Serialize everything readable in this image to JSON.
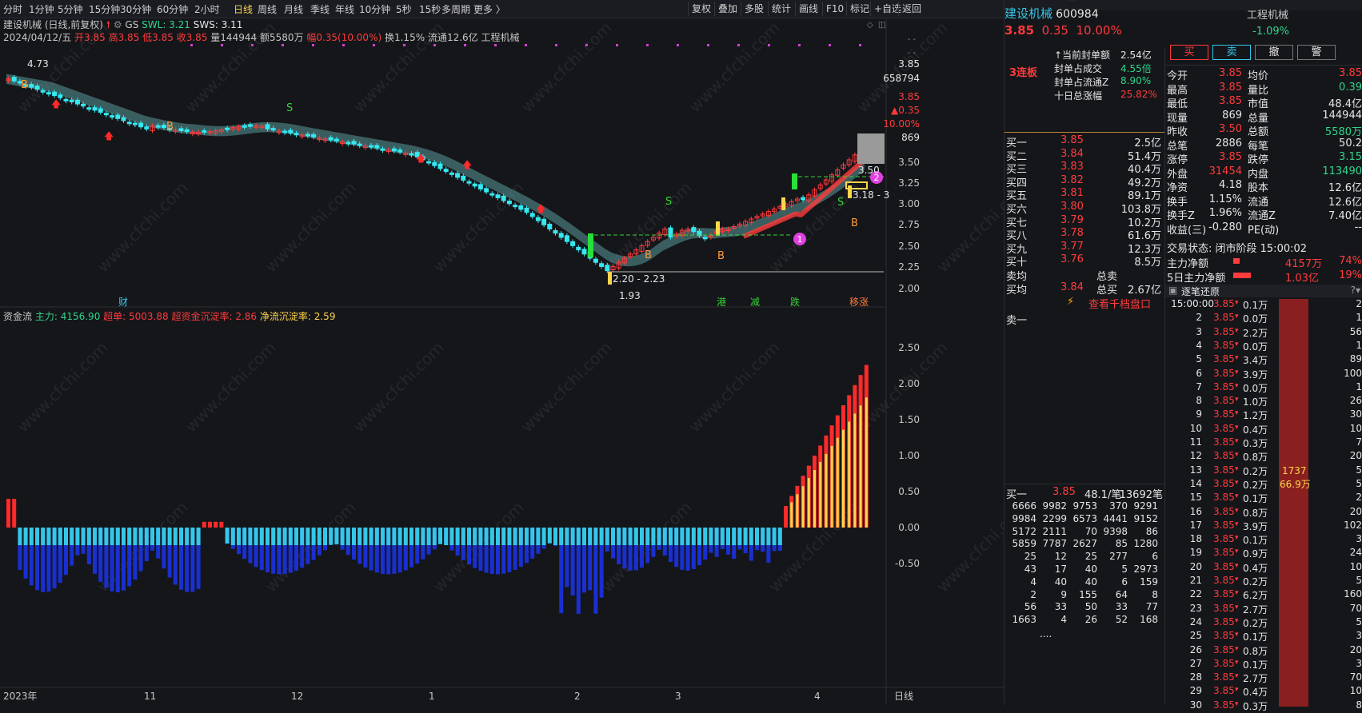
{
  "toolbar": {
    "periods": [
      "分时",
      "1分钟",
      "5分钟",
      "15分钟",
      "30分钟",
      "60分钟",
      "2小时",
      "日线",
      "周线",
      "月线",
      "季线",
      "年线",
      "10分钟",
      "5秒",
      "15秒",
      "多周期",
      "更多 〉"
    ],
    "active_period": "日线",
    "actions": [
      "复权",
      "叠加",
      "多股",
      "统计",
      "画线",
      "F10",
      "标记",
      "+自选",
      "返回"
    ]
  },
  "chart": {
    "title": "建设机械 (日线,前复权)",
    "indicator_gs": "GS",
    "swl": "SWL: 3.21",
    "sws": "SWS: 3.11",
    "ohlc_line": "2024/04/12/五",
    "open": "开3.85",
    "high": "高3.85",
    "low": "低3.85",
    "close": "收3.85",
    "volume": "量144944",
    "amount": "额5580万",
    "change": "幅0.35(10.00%)",
    "turnover": "换1.15%",
    "float": "流通12.6亿",
    "sector": "工程机械",
    "label_high": "4.73",
    "label_low": "1.93",
    "label_range1": "2.20 - 2.23",
    "label_range2": "3.18 - 3",
    "label_350": "3.50",
    "marker1": "1",
    "marker2": "2",
    "price_axis": [
      "3.50",
      "3.25",
      "3.00",
      "2.75",
      "2.50",
      "2.25",
      "2.00"
    ],
    "right_price": "3.85",
    "right_vol": "658794",
    "right_price_red": "3.85",
    "right_change": "▲0.35",
    "right_pct": "10.00%",
    "right_869": "869",
    "events": [
      "财",
      "港",
      "减",
      "跌",
      "移涨"
    ],
    "signals": [
      "B",
      "S"
    ]
  },
  "fund": {
    "title": "资金流",
    "main": "主力: 4156.90",
    "super": "超单: 5003.88",
    "super_rate": "超资金沉淀率: 2.86",
    "net_rate": "净流沉淀率: 2.59",
    "axis": [
      "2.50",
      "2.00",
      "1.50",
      "1.00",
      "0.50",
      "0.00",
      "-0.50"
    ]
  },
  "x_axis": [
    "2023年",
    "11",
    "12",
    "1",
    "2",
    "3",
    "4"
  ],
  "x_axis_right": "日线",
  "watermark": "www.cfchi.com",
  "quote": {
    "name": "建设机械",
    "code": "600984",
    "sector": "工程机械",
    "sector_pct": "-1.09%",
    "price": "3.85",
    "change": "0.35",
    "pct": "10.00%",
    "buttons": [
      "买",
      "卖",
      "撤",
      "警"
    ],
    "limit_tag": "3连板",
    "seal_amount_label": "↑当前封单额",
    "seal_amount": "2.54亿",
    "seal_deal_label": "封单占成交",
    "seal_deal": "4.55倍",
    "seal_float_label": "封单占流通Z",
    "seal_float": "8.90%",
    "ten_day_label": "十日总涨幅",
    "ten_day": "25.82%",
    "bids": [
      {
        "label": "买一",
        "price": "3.85",
        "vol": "2.5亿"
      },
      {
        "label": "买二",
        "price": "3.84",
        "vol": "51.4万"
      },
      {
        "label": "买三",
        "price": "3.83",
        "vol": "40.4万"
      },
      {
        "label": "买四",
        "price": "3.82",
        "vol": "49.2万"
      },
      {
        "label": "买五",
        "price": "3.81",
        "vol": "89.1万"
      },
      {
        "label": "买六",
        "price": "3.80",
        "vol": "103.8万"
      },
      {
        "label": "买七",
        "price": "3.79",
        "vol": "10.2万"
      },
      {
        "label": "买八",
        "price": "3.78",
        "vol": "61.6万"
      },
      {
        "label": "买九",
        "price": "3.77",
        "vol": "12.3万"
      },
      {
        "label": "买十",
        "price": "3.76",
        "vol": "8.5万"
      }
    ],
    "sell_avg_label": "卖均",
    "total_sell_label": "总卖",
    "buy_avg_label": "买均",
    "buy_avg": "3.84",
    "total_buy_label": "总买",
    "total_buy": "2.67亿",
    "view_levels": "查看千档盘口",
    "sell1_label": "卖一",
    "queue_head": {
      "label": "买一",
      "price": "3.85",
      "avg": "48.1/笔",
      "count": "13692笔"
    },
    "queue": [
      [
        "6666",
        "9982",
        "9753",
        "370",
        "9291"
      ],
      [
        "9984",
        "2299",
        "6573",
        "4441",
        "9152"
      ],
      [
        "5172",
        "2111",
        "70",
        "9398",
        "86"
      ],
      [
        "5859",
        "7787",
        "2627",
        "85",
        "1280"
      ],
      [
        "25",
        "12",
        "25",
        "277",
        "6"
      ],
      [
        "43",
        "17",
        "40",
        "5",
        "2973"
      ],
      [
        "4",
        "40",
        "40",
        "6",
        "159"
      ],
      [
        "2",
        "9",
        "155",
        "64",
        "8"
      ],
      [
        "56",
        "33",
        "50",
        "33",
        "77"
      ],
      [
        "1663",
        "4",
        "26",
        "52",
        "168"
      ]
    ],
    "queue_more": "....",
    "stats": [
      {
        "l1": "今开",
        "v1": "3.85",
        "l2": "均价",
        "v2": "3.85"
      },
      {
        "l1": "最高",
        "v1": "3.85",
        "l2": "量比",
        "v2": "0.39"
      },
      {
        "l1": "最低",
        "v1": "3.85",
        "l2": "市值",
        "v2": "48.4亿"
      },
      {
        "l1": "现量",
        "v1": "869",
        "l2": "总量",
        "v2": "144944"
      },
      {
        "l1": "昨收",
        "v1": "3.50",
        "l2": "总额",
        "v2": "5580万"
      },
      {
        "l1": "总笔",
        "v1": "2886",
        "l2": "每笔",
        "v2": "50.2"
      },
      {
        "l1": "涨停",
        "v1": "3.85",
        "l2": "跌停",
        "v2": "3.15"
      },
      {
        "l1": "外盘",
        "v1": "31454",
        "l2": "内盘",
        "v2": "113490"
      },
      {
        "l1": "净资",
        "v1": "4.18",
        "l2": "股本",
        "v2": "12.6亿"
      },
      {
        "l1": "换手",
        "v1": "1.15%",
        "l2": "流通",
        "v2": "12.6亿"
      },
      {
        "l1": "换手Z",
        "v1": "1.96%",
        "l2": "流通Z",
        "v2": "7.40亿"
      },
      {
        "l1": "收益(三)",
        "v1": "-0.280",
        "l2": "PE(动)",
        "v2": "--"
      }
    ],
    "trade_state": "交易状态: 闭市阶段 15:00:02",
    "main_net_label": "主力净额",
    "main_net": "4157万",
    "main_net_pct": "74%",
    "main_net5_label": "5日主力净额",
    "main_net5": "1.03亿",
    "main_net5_pct": "19%",
    "tick_title": "逐笔还原",
    "ticks": [
      {
        "t": "15:00:00",
        "p": "3.85",
        "v": "0.1万",
        "n": "2"
      },
      {
        "t": "2",
        "p": "3.85",
        "v": "0.0万",
        "n": "1"
      },
      {
        "t": "3",
        "p": "3.85",
        "v": "2.2万",
        "n": "56"
      },
      {
        "t": "4",
        "p": "3.85",
        "v": "0.0万",
        "n": "1"
      },
      {
        "t": "5",
        "p": "3.85",
        "v": "3.4万",
        "n": "89"
      },
      {
        "t": "6",
        "p": "3.85",
        "v": "3.9万",
        "n": "100"
      },
      {
        "t": "7",
        "p": "3.85",
        "v": "0.0万",
        "n": "1"
      },
      {
        "t": "8",
        "p": "3.85",
        "v": "1.0万",
        "n": "26"
      },
      {
        "t": "9",
        "p": "3.85",
        "v": "1.2万",
        "n": "30"
      },
      {
        "t": "10",
        "p": "3.85",
        "v": "0.4万",
        "n": "10"
      },
      {
        "t": "11",
        "p": "3.85",
        "v": "0.3万",
        "n": "7"
      },
      {
        "t": "12",
        "p": "3.85",
        "v": "0.8万",
        "n": "20"
      },
      {
        "t": "13",
        "p": "3.85",
        "v": "0.2万",
        "n": "5"
      },
      {
        "t": "14",
        "p": "3.85",
        "v": "0.2万",
        "n": "5"
      },
      {
        "t": "15",
        "p": "3.85",
        "v": "0.1万",
        "n": "2"
      },
      {
        "t": "16",
        "p": "3.85",
        "v": "0.8万",
        "n": "20"
      },
      {
        "t": "17",
        "p": "3.85",
        "v": "3.9万",
        "n": "102"
      },
      {
        "t": "18",
        "p": "3.85",
        "v": "0.1万",
        "n": "3"
      },
      {
        "t": "19",
        "p": "3.85",
        "v": "0.9万",
        "n": "24"
      },
      {
        "t": "20",
        "p": "3.85",
        "v": "0.4万",
        "n": "10"
      },
      {
        "t": "21",
        "p": "3.85",
        "v": "0.2万",
        "n": "5"
      },
      {
        "t": "22",
        "p": "3.85",
        "v": "6.2万",
        "n": "160"
      },
      {
        "t": "23",
        "p": "3.85",
        "v": "2.7万",
        "n": "70"
      },
      {
        "t": "24",
        "p": "3.85",
        "v": "0.2万",
        "n": "5"
      },
      {
        "t": "25",
        "p": "3.85",
        "v": "0.1万",
        "n": "3"
      },
      {
        "t": "26",
        "p": "3.85",
        "v": "0.8万",
        "n": "20"
      },
      {
        "t": "27",
        "p": "3.85",
        "v": "0.1万",
        "n": "3"
      },
      {
        "t": "28",
        "p": "3.85",
        "v": "2.7万",
        "n": "70"
      },
      {
        "t": "29",
        "p": "3.85",
        "v": "0.4万",
        "n": "10"
      },
      {
        "t": "30",
        "p": "3.85",
        "v": "0.3万",
        "n": "8"
      }
    ],
    "tick_bar_vol": "1737",
    "tick_bar_amt": "66.9万"
  },
  "colors": {
    "up": "#ff3b3b",
    "down": "#35e8f0",
    "bg": "#15161a",
    "accent": "#ffd54a"
  }
}
